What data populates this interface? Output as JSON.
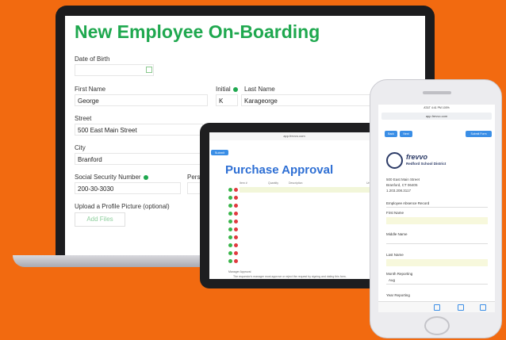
{
  "laptop": {
    "title": "New Employee On-Boarding",
    "dob_label": "Date of Birth",
    "first_name_label": "First Name",
    "first_name_value": "George",
    "initial_label": "Initial",
    "initial_value": "K",
    "last_name_label": "Last Name",
    "last_name_value": "Karageorge",
    "street_label": "Street",
    "street_value": "500 East Main Street",
    "city_label": "City",
    "city_value": "Branford",
    "ssn_label": "Social Security Number",
    "ssn_value": "200-30-3030",
    "pers_label": "Pers",
    "upload_label": "Upload a Profile Picture (optional)",
    "upload_button": "Add Files"
  },
  "tablet": {
    "url": "app.frevvo.com",
    "top_button": "Submit",
    "title": "Purchase Approval",
    "col_item": "Item #",
    "col_qty": "Quantity",
    "col_desc": "Description",
    "col_unit": "Unit",
    "footer_label": "Manager Approval",
    "footer_text": "The requestor's manager must approve or reject the request by signing and dating this form."
  },
  "phone": {
    "status": "AT&T  4:41 PM  100%",
    "url": "app.frevvo.com",
    "btn_back": "Back",
    "btn_next": "Next",
    "btn_submit": "Submit Form",
    "brand": "frevvo",
    "org": "Redford School District",
    "addr1": "500 East Main Street",
    "addr2": "Branford, CT 06405",
    "phone": "1.203.208.3117",
    "record_label": "Employee Absence Record",
    "first_name_label": "First Name",
    "middle_name_label": "Middle Name",
    "last_name_label": "Last Name",
    "month_label": "Month Reporting",
    "month_value": "Aug",
    "year_label": "Year Reporting"
  }
}
